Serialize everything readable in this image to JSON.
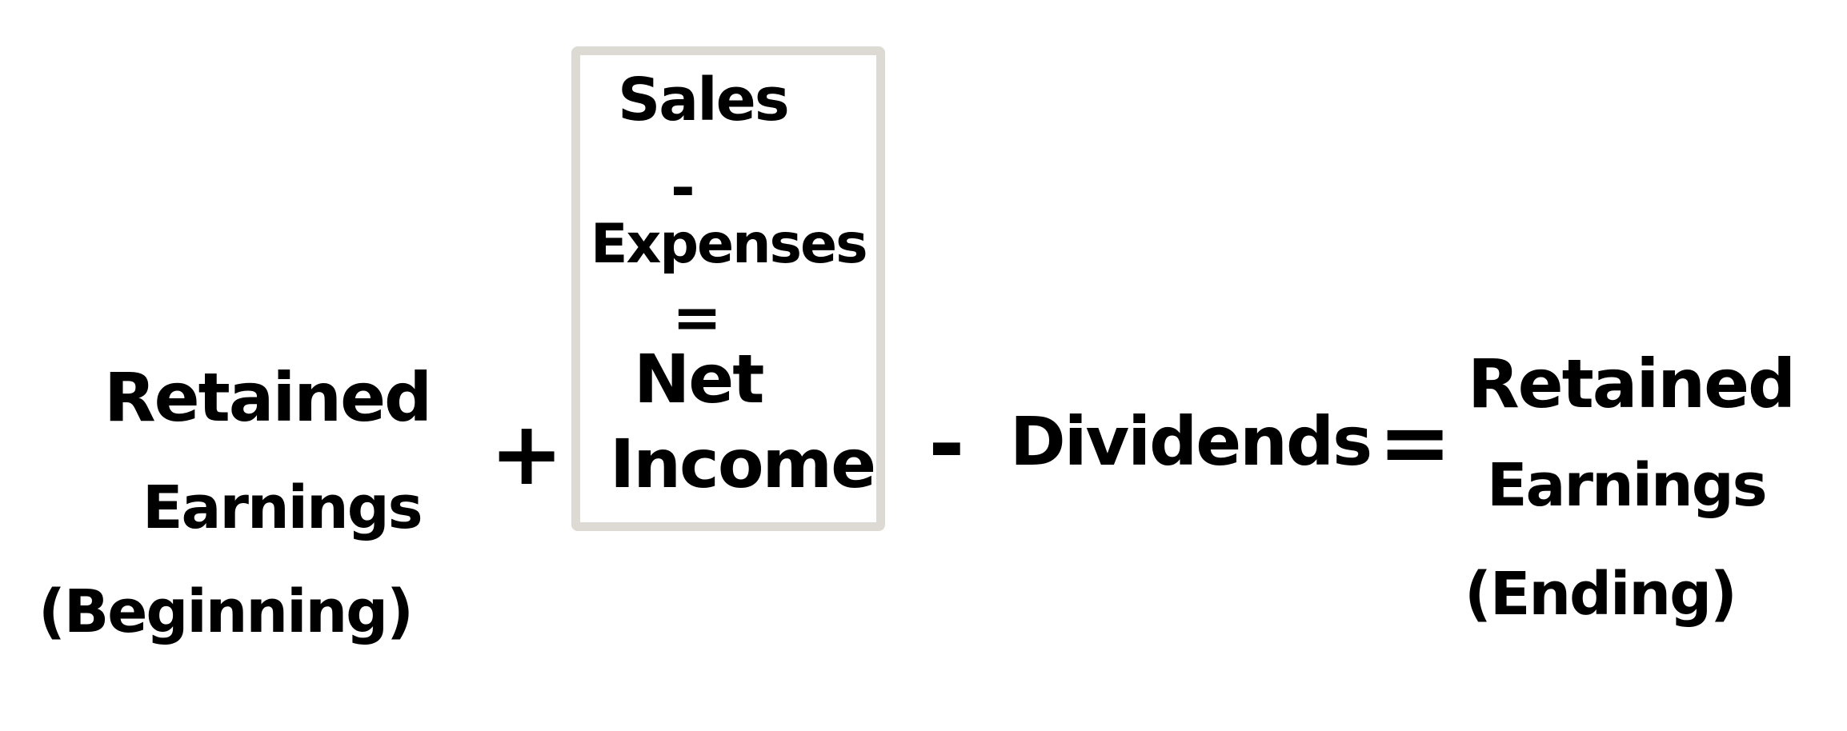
{
  "beginning": {
    "line1": "Retained",
    "line2": "Earnings",
    "line3": "(Beginning)"
  },
  "plus": "+",
  "income_box": {
    "sales": "Sales",
    "minus": "-",
    "expenses": "Expenses",
    "equals": "=",
    "net": "Net",
    "income": "Income",
    "border_color": "#dcdad3"
  },
  "minus": "-",
  "dividends": "Dividends",
  "equals": "=",
  "ending": {
    "line1": "Retained",
    "line2": "Earnings",
    "line3": "(Ending)"
  }
}
